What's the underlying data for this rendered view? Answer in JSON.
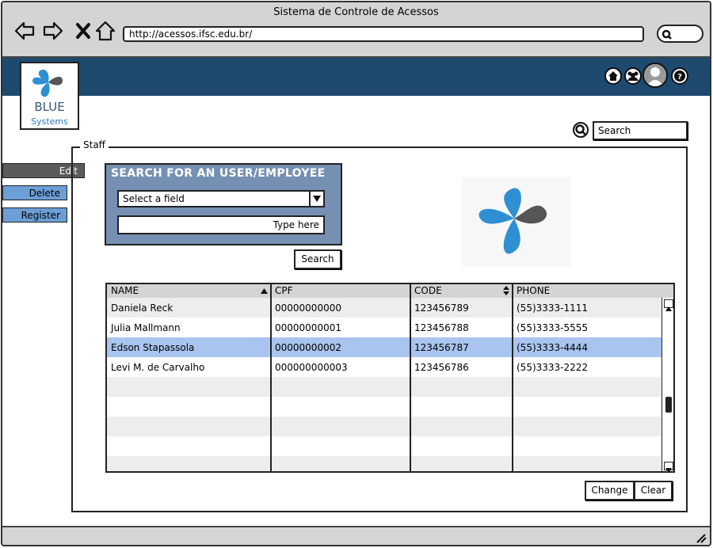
{
  "window": {
    "title": "Sistema de Controle de Acessos",
    "url": "http://acessos.ifsc.edu.br/"
  },
  "brand": {
    "name_line1": "BLUE",
    "name_line2": "Systems"
  },
  "header_search": {
    "placeholder": "Search"
  },
  "menu": {
    "edit": "Edit",
    "delete": "Delete",
    "register": "Register"
  },
  "staff": {
    "legend": "Staff",
    "search_panel": {
      "title": "SEARCH FOR AN USER/EMPLOYEE",
      "select_value": "Select a field",
      "input_placeholder": "Type here",
      "search_button": "Search"
    },
    "table": {
      "columns": [
        "NAME",
        "CPF",
        "CODE",
        "PHONE"
      ],
      "rows": [
        {
          "name": "Daniela Reck",
          "cpf": "00000000000",
          "code": "123456789",
          "phone": "(55)3333-1111"
        },
        {
          "name": "Julia Mallmann",
          "cpf": "00000000001",
          "code": "123456788",
          "phone": "(55)3333-5555"
        },
        {
          "name": "Edson Stapassola",
          "cpf": "00000000002",
          "code": "123456787",
          "phone": "(55)3333-4444"
        },
        {
          "name": "Levi M. de Carvalho",
          "cpf": "000000000003",
          "code": "123456786",
          "phone": "(55)3333-2222"
        }
      ],
      "selected_row": 2
    },
    "buttons": {
      "change": "Change",
      "clear": "Clear"
    }
  },
  "colors": {
    "header": "#1e4a70",
    "menu_active": "#5b5b5b",
    "menu_item": "#6c9fd6",
    "panel": "#7590b3",
    "selected_row": "#a9c4ee",
    "logo_blue": "#2f8fd3",
    "logo_gray": "#555555"
  },
  "icons": [
    "back-arrow-icon",
    "forward-arrow-icon",
    "close-icon",
    "home-icon",
    "search-icon",
    "users-icon",
    "user-icon",
    "help-icon",
    "sort-asc-icon",
    "sort-icon",
    "dropdown-arrow-icon"
  ]
}
